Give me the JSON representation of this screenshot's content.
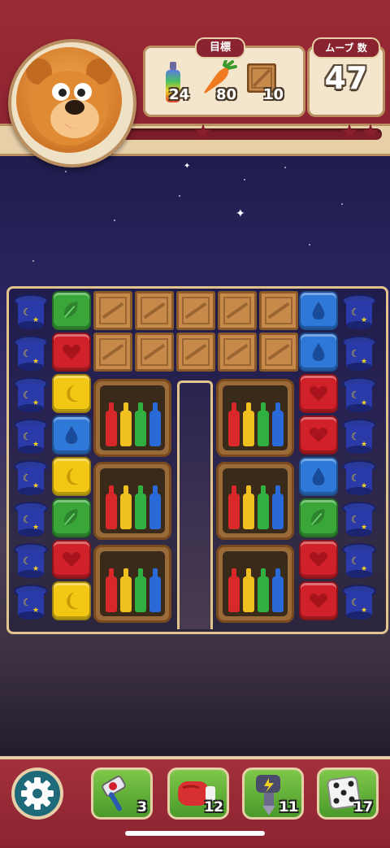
{
  "header": {
    "goal_label": "目標",
    "moves_label": "ムーブ 数",
    "moves_value": "47",
    "goals": [
      {
        "icon": "bottle-icon",
        "count": "24"
      },
      {
        "icon": "carrot-icon",
        "count": "80"
      },
      {
        "icon": "crate-icon",
        "count": "10"
      }
    ]
  },
  "colors": {
    "red": "#d0202a",
    "green": "#3aa63a",
    "blue": "#2e78d8",
    "yellow": "#f2c814",
    "frame": "#8a2330"
  },
  "board": {
    "left_column": [
      "green",
      "red",
      "yellow",
      "blue",
      "yellow",
      "green",
      "red",
      "yellow"
    ],
    "right_column": [
      "blue",
      "blue",
      "red",
      "red",
      "blue",
      "green",
      "red",
      "red"
    ]
  },
  "boosters": [
    {
      "name": "hammer-booster",
      "count": "3"
    },
    {
      "name": "boxing-glove-booster",
      "count": "12"
    },
    {
      "name": "drill-booster",
      "count": "11"
    },
    {
      "name": "dice-booster",
      "count": "17"
    }
  ]
}
